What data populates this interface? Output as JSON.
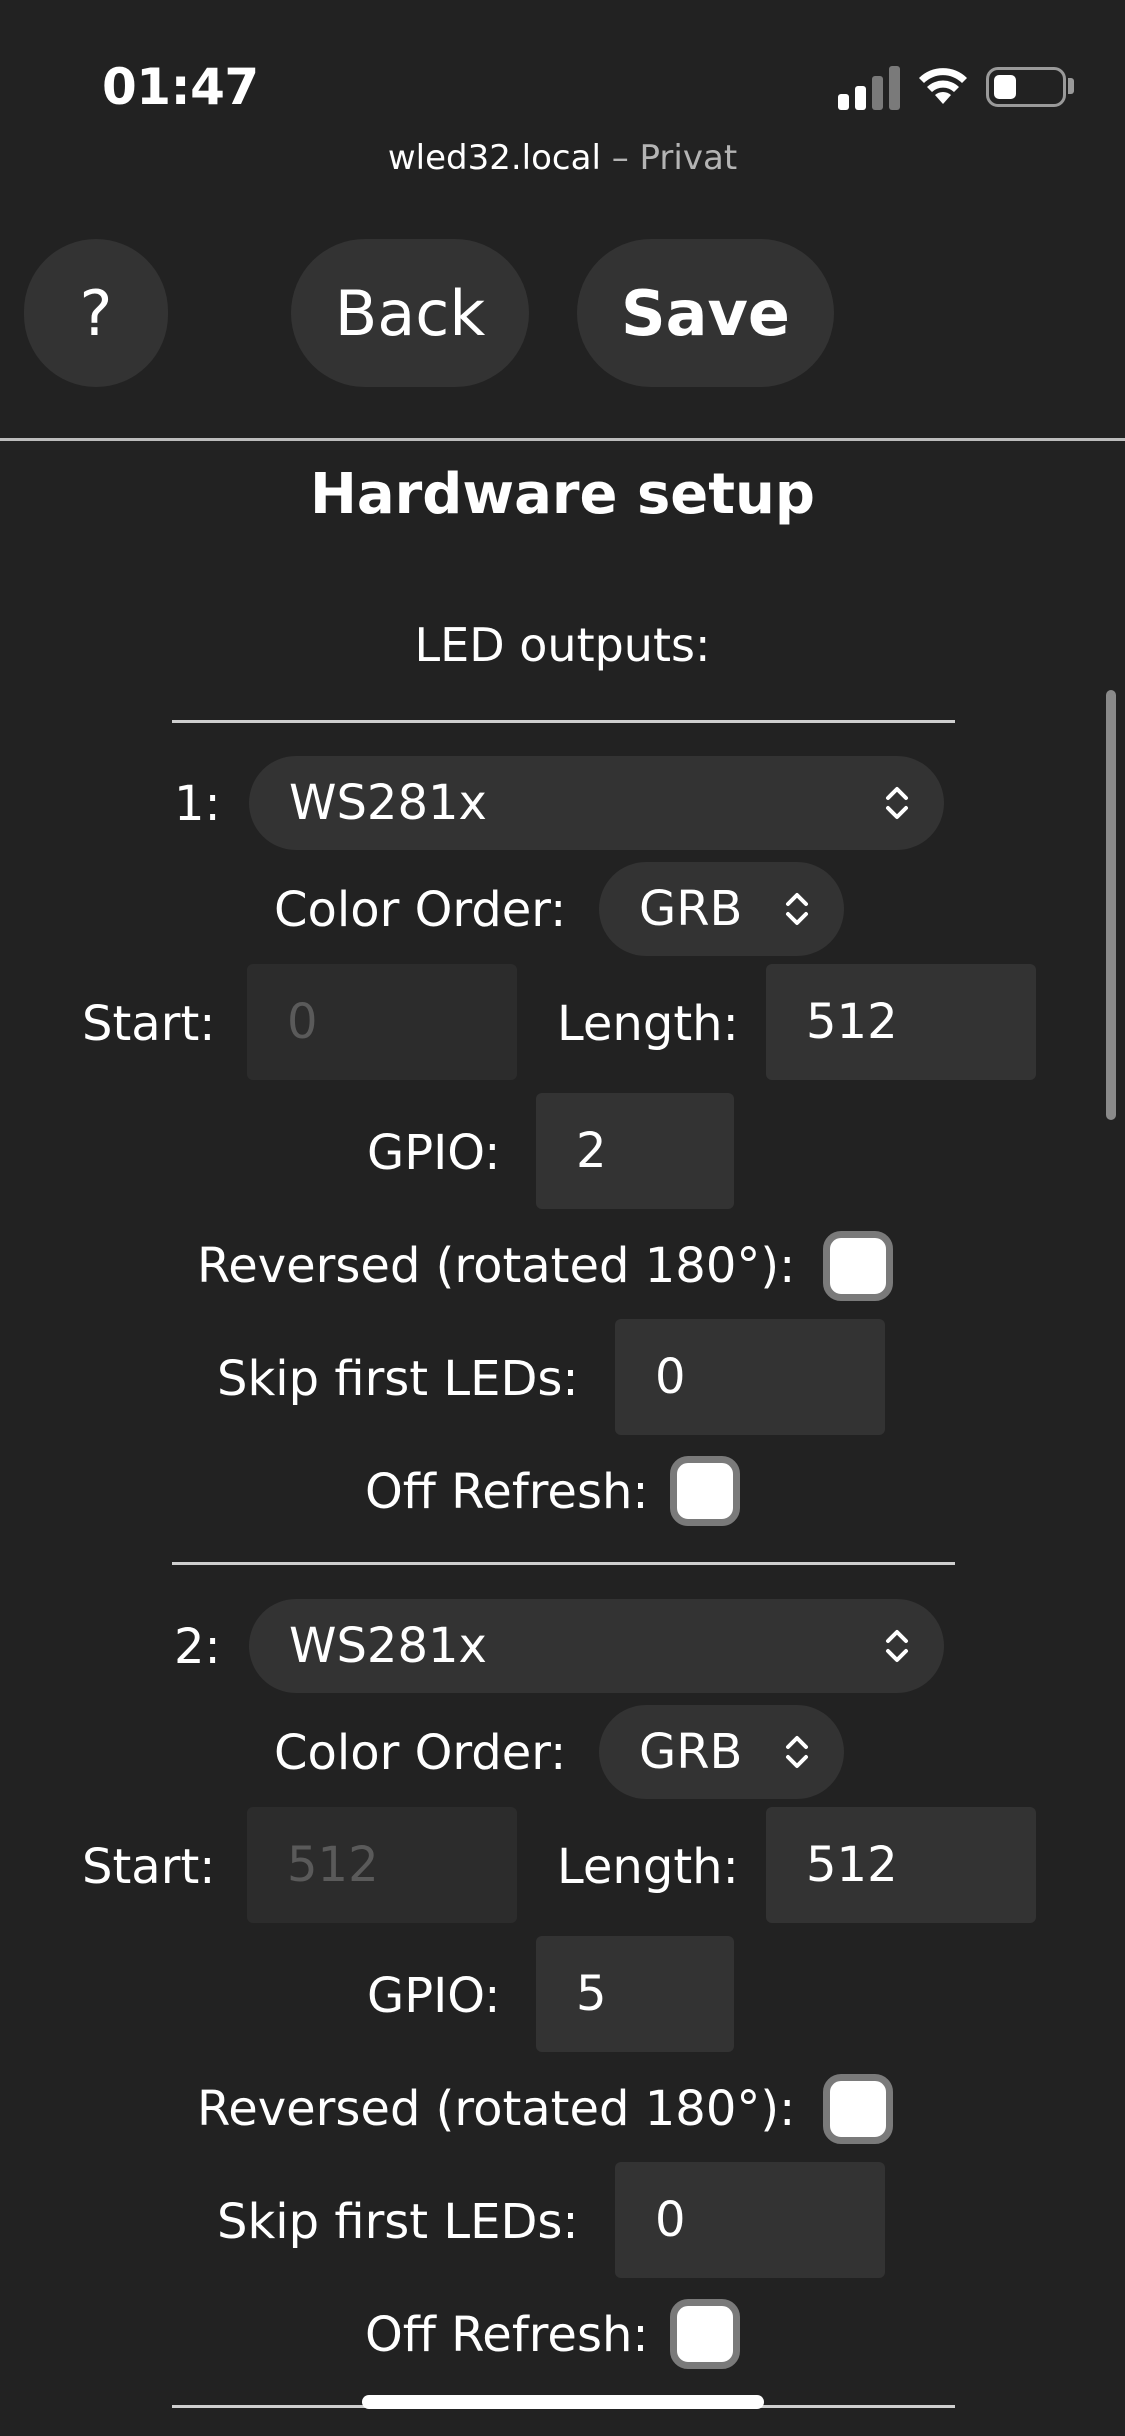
{
  "status": {
    "time": "01:47"
  },
  "browser": {
    "host": "wled32.local",
    "separator": "–",
    "mode": "Privat"
  },
  "toolbar": {
    "help_label": "?",
    "back_label": "Back",
    "save_label": "Save"
  },
  "page": {
    "title": "Hardware setup",
    "section_label": "LED outputs:"
  },
  "labels": {
    "color_order": "Color Order:",
    "start": "Start:",
    "length": "Length:",
    "gpio": "GPIO:",
    "reversed": "Reversed (rotated 180°):",
    "skip": "Skip first LEDs:",
    "off_refresh": "Off Refresh:"
  },
  "outputs": [
    {
      "index": "1:",
      "type": "WS281x",
      "color_order": "GRB",
      "start": "0",
      "length": "512",
      "gpio": "2",
      "skip": "0",
      "reversed": false,
      "off_refresh": false
    },
    {
      "index": "2:",
      "type": "WS281x",
      "color_order": "GRB",
      "start": "512",
      "length": "512",
      "gpio": "5",
      "skip": "0",
      "reversed": false,
      "off_refresh": false
    }
  ],
  "colors": {
    "background": "#222222",
    "control": "#333333",
    "text": "#ffffff"
  }
}
